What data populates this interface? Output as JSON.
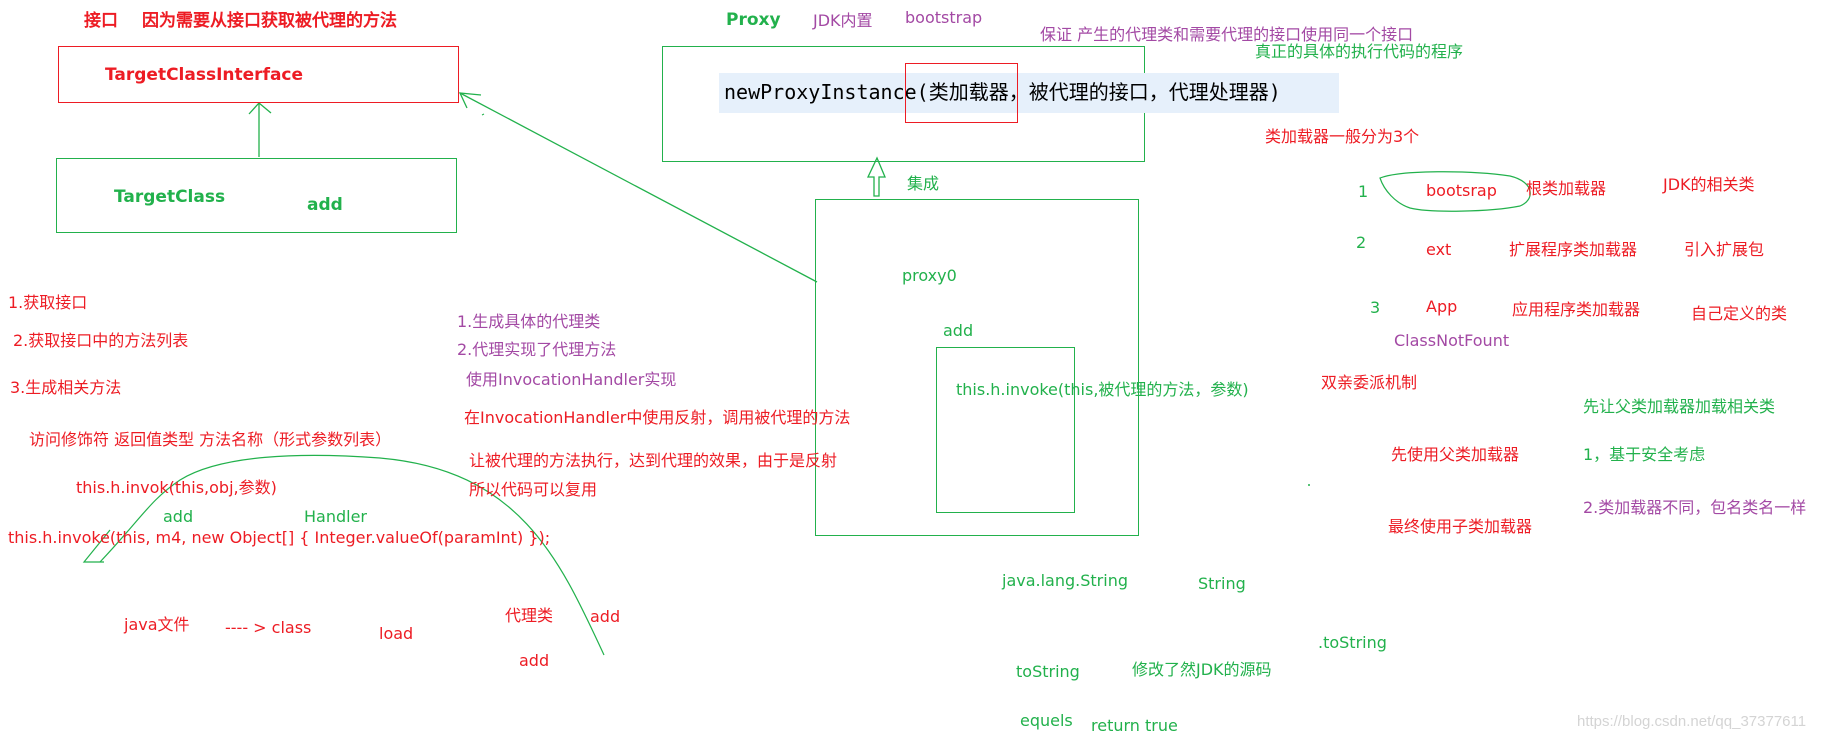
{
  "colors": {
    "red": "#ed1c24",
    "green": "#22b14c",
    "purple": "#a349a4",
    "highlight": "#e6f0fb"
  },
  "interface_section": {
    "heading_label": "接口",
    "heading_reason": "因为需要从接口获取被代理的方法",
    "interface_name": "TargetClassInterface",
    "class_name": "TargetClass",
    "class_method": "add"
  },
  "proxy_section": {
    "title": "Proxy",
    "jdk_builtin": "JDK内置",
    "bootstrap": "bootstrap",
    "guarantee_note": "保证  产生的代理类和需要代理的接口使用同一个接口",
    "real_code_note": "真正的具体的执行代码的程序",
    "method_name": "newProxyInstance",
    "method_args": "(类加载器，被代理的接口，代理处理器)",
    "inherit_label": "集成",
    "proxy_class_name": "proxy0",
    "proxy_method": "add",
    "invoke_call": "this.h.invoke(this,被代理的方法，参数)"
  },
  "classloader_section": {
    "summary": "类加载器一般分为3个",
    "loaders": [
      {
        "num": "1",
        "name": "bootsrap",
        "desc": "根类加载器",
        "scope": "JDK的相关类"
      },
      {
        "num": "2",
        "name": "ext",
        "desc": "扩展程序类加载器",
        "scope": "引入扩展包"
      },
      {
        "num": "3",
        "name": "App",
        "desc": "应用程序类加载器",
        "scope": "自己定义的类"
      }
    ],
    "exception": "ClassNotFount",
    "delegation": "双亲委派机制",
    "parent_first_note": "先让父类加载器加载相关类",
    "use_parent": "先使用父类加载器",
    "use_child": "最终使用子类加载器",
    "reason_1": "1，基于安全考虑",
    "reason_2": "2.类加载器不同，包名类名一样"
  },
  "steps": {
    "step1": "1.获取接口",
    "step2": "2.获取接口中的方法列表",
    "step3": "3.生成相关方法",
    "signature": "访问修饰符     返回值类型  方法名称（形式参数列表）",
    "invok_call": "this.h.invok(this,obj,参数)",
    "add_label": "add",
    "handler_label": "Handler",
    "invoke_full": "this.h.invoke(this, m4, new Object[] { Integer.valueOf(paramInt) });"
  },
  "proxy_notes": {
    "gen_class": "1.生成具体的代理类",
    "impl_method": "2.代理实现了代理方法",
    "use_handler": "使用InvocationHandler实现",
    "reflection": "在InvocationHandler中使用反射，调用被代理的方法",
    "effect_line1": "让被代理的方法执行，达到代理的效果，由于是反射",
    "effect_line2": "所以代码可以复用"
  },
  "bottom": {
    "java_file": "java文件",
    "to_class": "---- > class",
    "load": "load",
    "proxy_class": "代理类",
    "add_right": "add",
    "add_below": "add",
    "java_lang_string": "java.lang.String",
    "string": "String",
    "to_string_dot": ".toString",
    "to_string": "toString",
    "modified_jdk": "修改了然JDK的源码",
    "equels": "equels",
    "return_true": "return true"
  },
  "watermark": "https://blog.csdn.net/qq_37377611"
}
